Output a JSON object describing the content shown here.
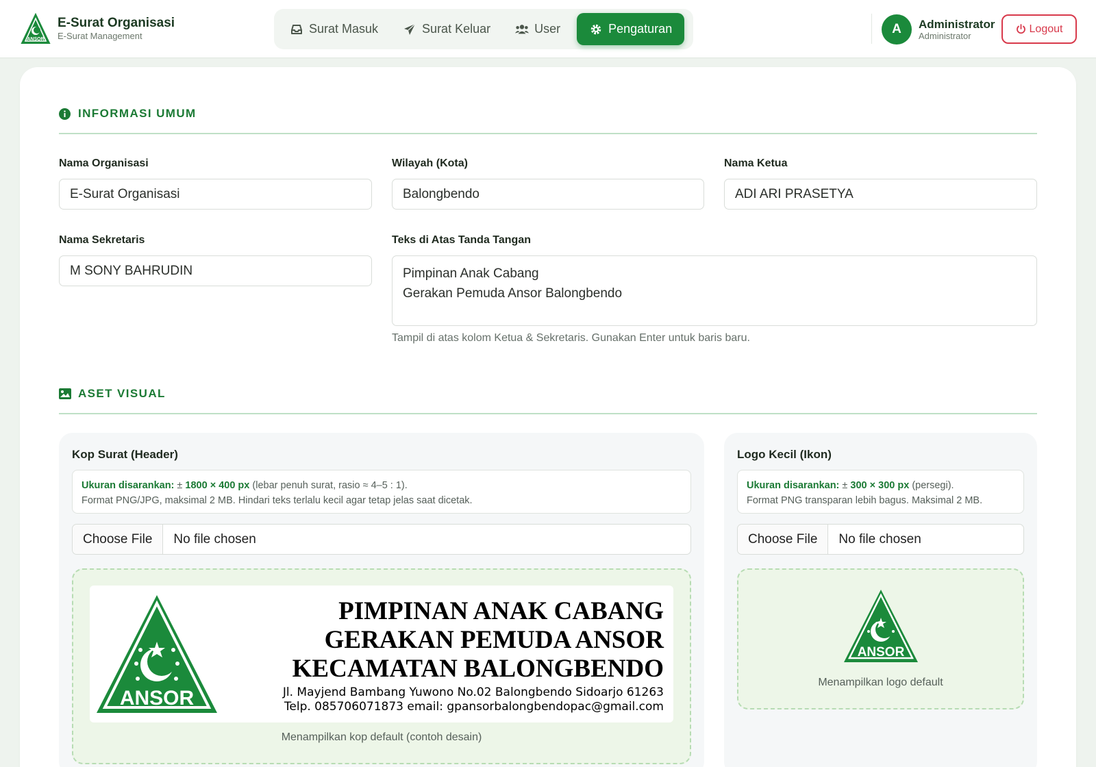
{
  "brand": {
    "title": "E-Surat Organisasi",
    "subtitle": "E-Surat Management",
    "logo_icon": "ansor-logo-icon",
    "logo_text": "ANSOR"
  },
  "nav": {
    "items": [
      {
        "label": "Surat Masuk",
        "icon": "inbox-icon"
      },
      {
        "label": "Surat Keluar",
        "icon": "send-icon"
      },
      {
        "label": "User",
        "icon": "users-icon"
      },
      {
        "label": "Pengaturan",
        "icon": "gear-icon",
        "active": true
      }
    ]
  },
  "user": {
    "initial": "A",
    "name": "Administrator",
    "role": "Administrator"
  },
  "logout_label": "Logout",
  "colors": {
    "accent": "#1b8a3b",
    "danger": "#d8394b",
    "section": "#1b7a34"
  },
  "info_umum": {
    "heading": "INFORMASI UMUM",
    "nama_organisasi": {
      "label": "Nama Organisasi",
      "value": "E-Surat Organisasi"
    },
    "wilayah": {
      "label": "Wilayah (Kota)",
      "value": "Balongbendo"
    },
    "nama_ketua": {
      "label": "Nama Ketua",
      "value": "ADI ARI PRASETYA"
    },
    "nama_sekretaris": {
      "label": "Nama Sekretaris",
      "value": "M SONY BAHRUDIN"
    },
    "teks_ttd": {
      "label": "Teks di Atas Tanda Tangan",
      "value": "Pimpinan Anak Cabang\nGerakan Pemuda Ansor Balongbendo",
      "hint": "Tampil di atas kolom Ketua & Sekretaris. Gunakan Enter untuk baris baru."
    }
  },
  "aset_visual": {
    "heading": "ASET VISUAL",
    "kop": {
      "title": "Kop Surat (Header)",
      "size_label": "Ukuran disarankan:",
      "size_prefix": "±",
      "size_value": "1800 × 400 px",
      "size_note": "(lebar penuh surat, rasio ≈ 4–5 : 1).",
      "format_note": "Format PNG/JPG, maksimal 2 MB. Hindari teks terlalu kecil agar tetap jelas saat dicetak.",
      "file_button": "Choose File",
      "file_status": "No file chosen",
      "preview_lines": [
        "PIMPINAN ANAK CABANG",
        "GERAKAN PEMUDA ANSOR",
        "KECAMATAN BALONGBENDO"
      ],
      "preview_address": "Jl. Mayjend Bambang Yuwono No.02 Balongbendo Sidoarjo 61263",
      "preview_contact": "Telp. 085706071873 email: gpansorbalongbendopac@gmail.com",
      "preview_logo_text": "ANSOR",
      "caption": "Menampilkan kop default (contoh desain)"
    },
    "logo": {
      "title": "Logo Kecil (Ikon)",
      "size_label": "Ukuran disarankan:",
      "size_prefix": "±",
      "size_value": "300 × 300 px",
      "size_note": "(persegi).",
      "format_note": "Format PNG transparan lebih bagus. Maksimal 2 MB.",
      "file_button": "Choose File",
      "file_status": "No file chosen",
      "preview_logo_text": "ANSOR",
      "caption": "Menampilkan logo default"
    }
  }
}
